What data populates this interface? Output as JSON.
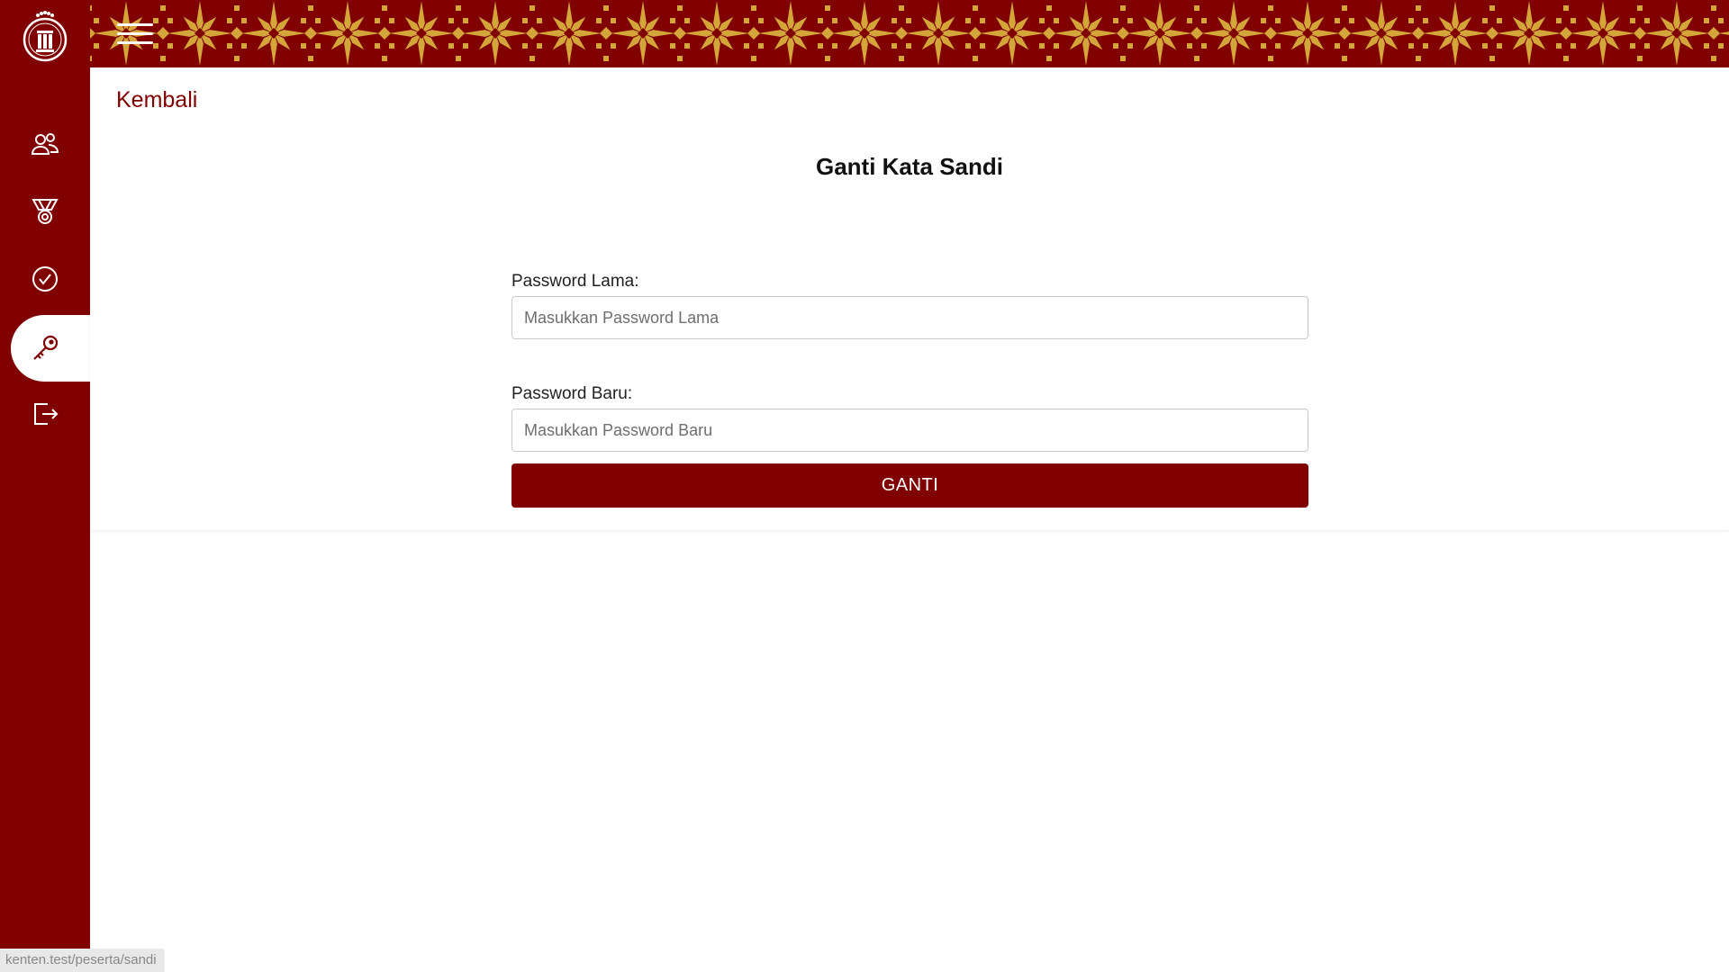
{
  "sidebar": {
    "logo": "school-emblem-logo",
    "items": [
      {
        "icon": "users-icon",
        "active": false
      },
      {
        "icon": "medal-icon",
        "active": false
      },
      {
        "icon": "check-circle-icon",
        "active": false
      },
      {
        "icon": "key-icon",
        "active": true
      },
      {
        "icon": "logout-icon",
        "active": false
      }
    ]
  },
  "header": {
    "menu_icon": "hamburger-icon"
  },
  "main": {
    "back_label": "Kembali",
    "title": "Ganti Kata Sandi",
    "old_password": {
      "label": "Password Lama:",
      "placeholder": "Masukkan Password Lama",
      "value": ""
    },
    "new_password": {
      "label": "Password Baru:",
      "placeholder": "Masukkan Password Baru",
      "value": ""
    },
    "submit_label": "GANTI"
  },
  "status": {
    "url": "kenten.test/peserta/sandi"
  },
  "colors": {
    "primary": "#800000",
    "pattern_gold": "#d4a63a",
    "background": "#ffffff"
  }
}
